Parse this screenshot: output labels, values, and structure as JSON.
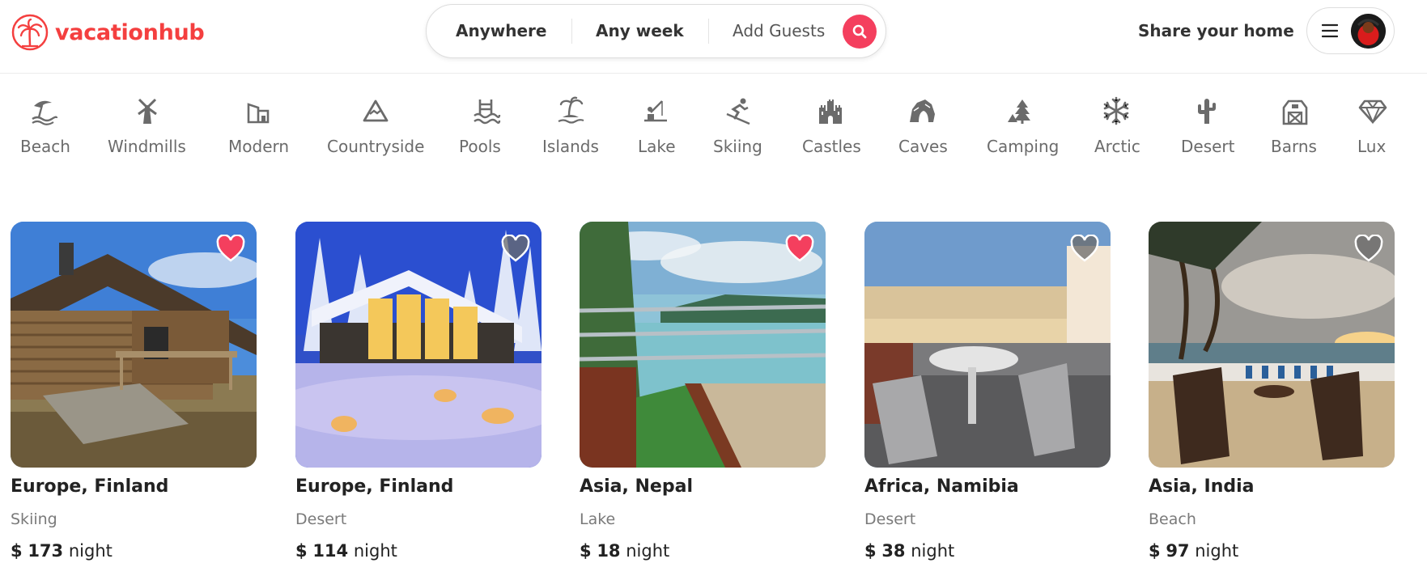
{
  "brand": {
    "name": "vacationhub",
    "color": "#f43f3f"
  },
  "search": {
    "anywhere": "Anywhere",
    "any_week": "Any week",
    "add_guests": "Add Guests",
    "button_color": "#f43f5e"
  },
  "header": {
    "share_home": "Share your home"
  },
  "categories": [
    {
      "label": "Beach",
      "icon": "beach-icon"
    },
    {
      "label": "Windmills",
      "icon": "windmill-icon"
    },
    {
      "label": "Modern",
      "icon": "modern-house-icon"
    },
    {
      "label": "Countryside",
      "icon": "mountain-icon"
    },
    {
      "label": "Pools",
      "icon": "pool-icon"
    },
    {
      "label": "Islands",
      "icon": "island-icon"
    },
    {
      "label": "Lake",
      "icon": "lake-icon"
    },
    {
      "label": "Skiing",
      "icon": "skiing-icon"
    },
    {
      "label": "Castles",
      "icon": "castle-icon"
    },
    {
      "label": "Caves",
      "icon": "cave-icon"
    },
    {
      "label": "Camping",
      "icon": "camping-icon"
    },
    {
      "label": "Arctic",
      "icon": "snowflake-icon"
    },
    {
      "label": "Desert",
      "icon": "cactus-icon"
    },
    {
      "label": "Barns",
      "icon": "barn-icon"
    },
    {
      "label": "Lux",
      "icon": "diamond-icon"
    }
  ],
  "listings": [
    {
      "location": "Europe, Finland",
      "category": "Skiing",
      "currency": "$",
      "price": "173",
      "unit": "night",
      "favorited": true
    },
    {
      "location": "Europe, Finland",
      "category": "Desert",
      "currency": "$",
      "price": "114",
      "unit": "night",
      "favorited": false
    },
    {
      "location": "Asia, Nepal",
      "category": "Lake",
      "currency": "$",
      "price": "18",
      "unit": "night",
      "favorited": true
    },
    {
      "location": "Africa, Namibia",
      "category": "Desert",
      "currency": "$",
      "price": "38",
      "unit": "night",
      "favorited": false
    },
    {
      "location": "Asia, India",
      "category": "Beach",
      "currency": "$",
      "price": "97",
      "unit": "night",
      "favorited": false
    }
  ],
  "colors": {
    "favorite_active": "#f43f5e",
    "favorite_inactive": "#6b6b6b"
  }
}
